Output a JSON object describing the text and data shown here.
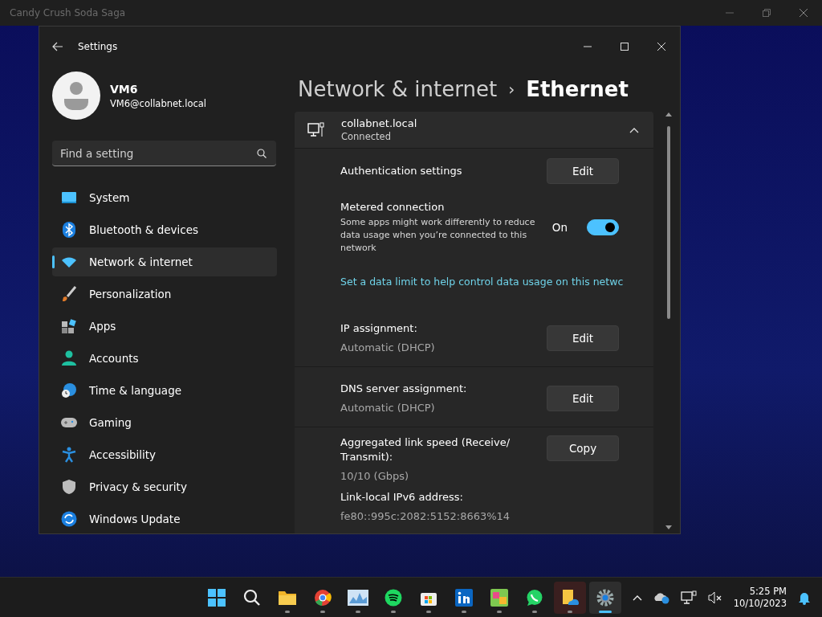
{
  "background_window": {
    "title": "Candy Crush Soda Saga"
  },
  "settings_window": {
    "title": "Settings"
  },
  "account": {
    "name": "VM6",
    "email": "VM6@collabnet.local"
  },
  "search": {
    "placeholder": "Find a setting"
  },
  "nav": [
    {
      "label": "System",
      "selected": false
    },
    {
      "label": "Bluetooth & devices",
      "selected": false
    },
    {
      "label": "Network & internet",
      "selected": true
    },
    {
      "label": "Personalization",
      "selected": false
    },
    {
      "label": "Apps",
      "selected": false
    },
    {
      "label": "Accounts",
      "selected": false
    },
    {
      "label": "Time & language",
      "selected": false
    },
    {
      "label": "Gaming",
      "selected": false
    },
    {
      "label": "Accessibility",
      "selected": false
    },
    {
      "label": "Privacy & security",
      "selected": false
    },
    {
      "label": "Windows Update",
      "selected": false
    }
  ],
  "breadcrumb": {
    "parent": "Network & internet",
    "separator": "›",
    "current": "Ethernet"
  },
  "connection": {
    "name": "collabnet.local",
    "status": "Connected",
    "expanded": true
  },
  "rows": [
    {
      "kind": "action",
      "label": "Authentication settings",
      "button": "Edit"
    },
    {
      "kind": "toggle",
      "label": "Metered connection",
      "description": "Some apps might work differently to reduce data usage when you’re connected to this network",
      "state": "On",
      "on": true
    },
    {
      "kind": "link",
      "label": "Set a data limit to help control data usage on this netwc"
    },
    {
      "kind": "value",
      "label": "IP assignment:",
      "value": "Automatic (DHCP)",
      "button": "Edit"
    },
    {
      "kind": "value",
      "label": "DNS server assignment:",
      "value": "Automatic (DHCP)",
      "button": "Edit"
    },
    {
      "kind": "properties",
      "button": "Copy",
      "items": [
        {
          "label": "Aggregated link speed (Receive/ Transmit):",
          "value": "10/10 (Gbps)"
        },
        {
          "label": "Link-local IPv6 address:",
          "value": "fe80::995c:2082:5152:8663%14"
        }
      ]
    }
  ],
  "taskbar": {
    "apps": [
      {
        "running": false,
        "selected": false,
        "flashing": false
      },
      {
        "running": false,
        "selected": false,
        "flashing": false
      },
      {
        "running": true,
        "selected": false,
        "flashing": false
      },
      {
        "running": true,
        "selected": false,
        "flashing": false
      },
      {
        "running": true,
        "selected": false,
        "flashing": false
      },
      {
        "running": true,
        "selected": false,
        "flashing": false
      },
      {
        "running": true,
        "selected": false,
        "flashing": false
      },
      {
        "running": true,
        "selected": false,
        "flashing": false
      },
      {
        "running": true,
        "selected": false,
        "flashing": false
      },
      {
        "running": true,
        "selected": false,
        "flashing": false
      },
      {
        "running": true,
        "selected": false,
        "flashing": true
      },
      {
        "running": true,
        "selected": true,
        "flashing": false
      }
    ],
    "time": "5:25 PM",
    "date": "10/10/2023"
  }
}
